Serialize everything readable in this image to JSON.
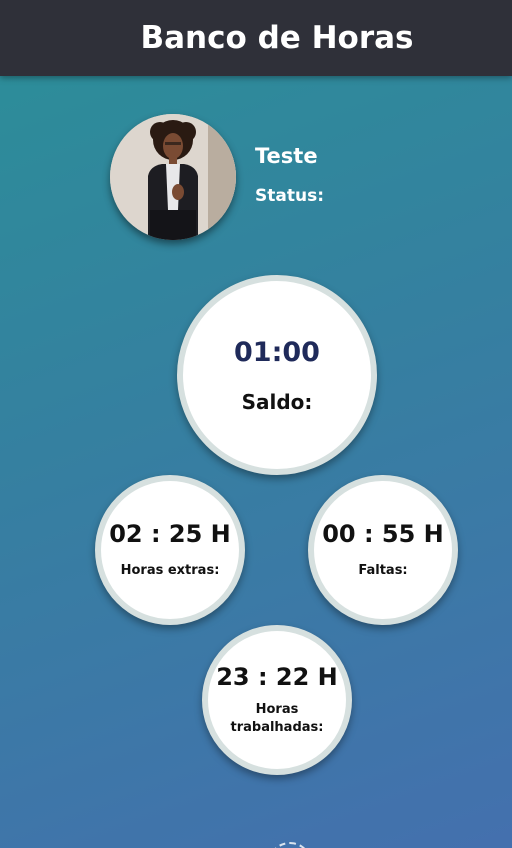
{
  "header": {
    "title": "Banco de Horas"
  },
  "user": {
    "name": "Teste",
    "status_label": "Status:"
  },
  "saldo": {
    "value": "01:00",
    "label": "Saldo:"
  },
  "extras": {
    "value": "02 : 25 H",
    "label": "Horas extras:"
  },
  "faltas": {
    "value": "00 : 55 H",
    "label": "Faltas:"
  },
  "trabalhadas": {
    "value": "23 : 22 H",
    "label_line1": "Horas",
    "label_line2": "trabalhadas:"
  },
  "colors": {
    "header_bg": "#2f3039",
    "gradient_top": "#2b8f98",
    "gradient_bottom": "#4470ae",
    "saldo_value": "#1f2a5a",
    "circle_border": "#d6e0df"
  }
}
